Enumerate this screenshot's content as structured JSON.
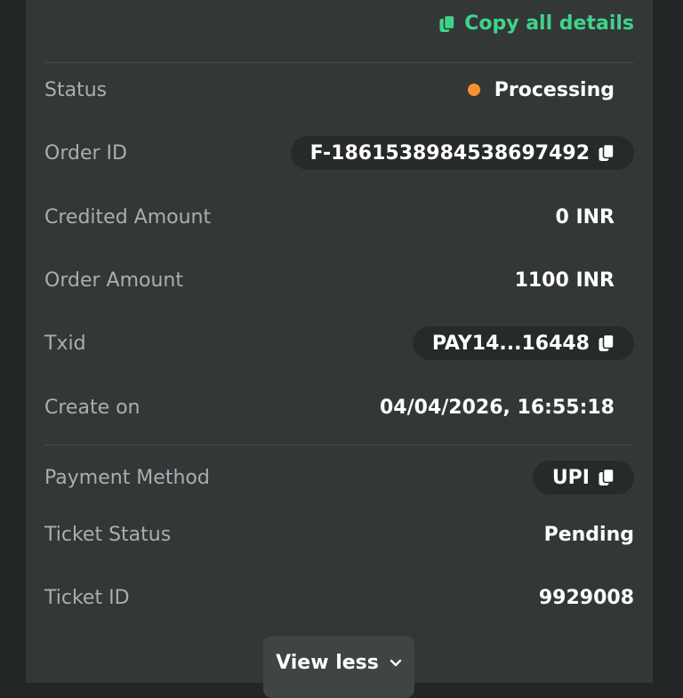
{
  "header": {
    "copy_all_label": "Copy all details",
    "accent_color": "#3fd38a"
  },
  "details": {
    "status": {
      "label": "Status",
      "value": "Processing",
      "dot_color": "#f5922e"
    },
    "order_id": {
      "label": "Order ID",
      "value": "F-1861538984538697492"
    },
    "credited_amount": {
      "label": "Credited Amount",
      "value": "0 INR"
    },
    "order_amount": {
      "label": "Order Amount",
      "value": "1100 INR"
    },
    "txid": {
      "label": "Txid",
      "value": "PAY14...16448"
    },
    "create_on": {
      "label": "Create on",
      "value": "04/04/2026, 16:55:18"
    }
  },
  "extra": {
    "payment_method": {
      "label": "Payment Method",
      "value": "UPI"
    },
    "ticket_status": {
      "label": "Ticket Status",
      "value": "Pending"
    },
    "ticket_id": {
      "label": "Ticket ID",
      "value": "9929008"
    }
  },
  "footer": {
    "view_less_label": "View less",
    "icon": "chevron-down-icon"
  },
  "icons": {
    "copy": "copy-icon",
    "status_dot": "status-dot-icon"
  }
}
